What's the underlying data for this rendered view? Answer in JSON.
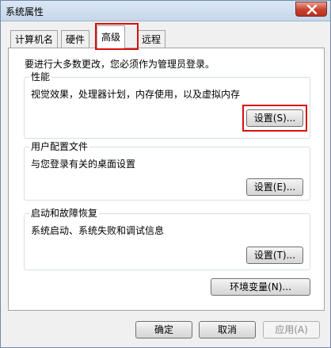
{
  "window": {
    "title": "系统属性"
  },
  "tabs": [
    {
      "label": "计算机名",
      "active": false
    },
    {
      "label": "硬件",
      "active": false
    },
    {
      "label": "高级",
      "active": true
    },
    {
      "label": "远程",
      "active": false
    }
  ],
  "advanced": {
    "admin_note": "要进行大多数更改，您必须作为管理员登录。",
    "performance": {
      "title": "性能",
      "description": "视觉效果，处理器计划，内存使用，以及虚拟内存",
      "button_label": "设置(S)..."
    },
    "user_profiles": {
      "title": "用户配置文件",
      "description": "与您登录有关的桌面设置",
      "button_label": "设置(E)..."
    },
    "startup_recovery": {
      "title": "启动和故障恢复",
      "description": "系统启动、系统失败和调试信息",
      "button_label": "设置(T)..."
    },
    "env_vars_label": "环境变量(N)..."
  },
  "footer": {
    "ok_label": "确定",
    "cancel_label": "取消",
    "apply_label": "应用(A)"
  },
  "colors": {
    "highlight": "#d81010",
    "close_button": "#c9402c"
  },
  "icons": {
    "close": "close-icon"
  }
}
